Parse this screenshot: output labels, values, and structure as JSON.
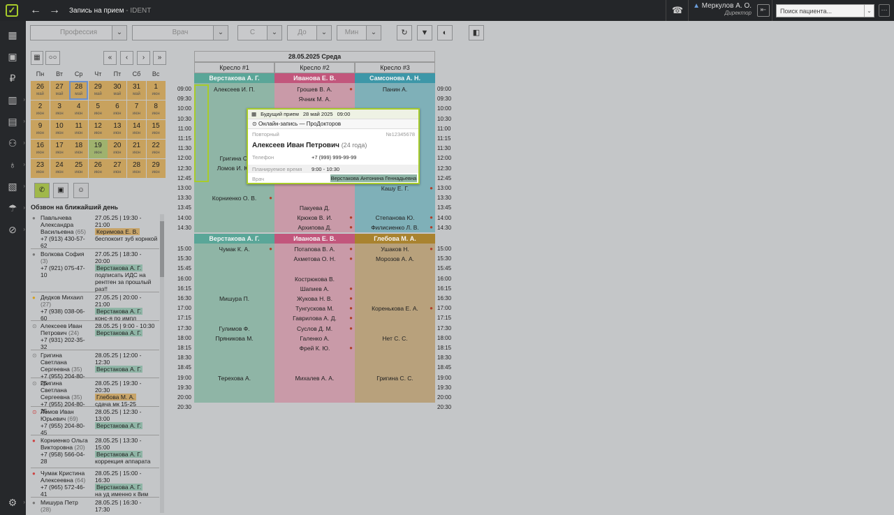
{
  "app": {
    "title": "Запись на прием",
    "subtitle": "- IDENT",
    "user_name": "Меркулов А. О.",
    "user_role": "Директор",
    "search_placeholder": "Поиск пациента...",
    "accent": "#a8cc2a"
  },
  "sidebar": {
    "icons": [
      "schedule-icon",
      "calendar-check-icon",
      "finance-icon",
      "clinic-icon",
      "reports-icon",
      "users-icon",
      "tooth-icon",
      "storage-icon",
      "insurance-icon",
      "marketing-icon",
      "settings-icon"
    ]
  },
  "filters": {
    "profession": "Профессия",
    "doctor": "Врач",
    "from": "С",
    "to": "До",
    "min": "Мин"
  },
  "calendar": {
    "weekdays": [
      "Пн",
      "Вт",
      "Ср",
      "Чт",
      "Пт",
      "Сб",
      "Вс"
    ],
    "rows": [
      [
        {
          "d": "26",
          "m": "май",
          "c": "or"
        },
        {
          "d": "27",
          "m": "май",
          "c": "or"
        },
        {
          "d": "28",
          "m": "май",
          "c": "or",
          "sel": true
        },
        {
          "d": "29",
          "m": "май",
          "c": "or"
        },
        {
          "d": "30",
          "m": "май",
          "c": "or"
        },
        {
          "d": "31",
          "m": "май",
          "c": "or"
        },
        {
          "d": "1",
          "m": "июн",
          "c": "or"
        }
      ],
      [
        {
          "d": "2",
          "m": "июн",
          "c": "or"
        },
        {
          "d": "3",
          "m": "июн",
          "c": "or"
        },
        {
          "d": "4",
          "m": "июн",
          "c": "or"
        },
        {
          "d": "5",
          "m": "июн",
          "c": "or"
        },
        {
          "d": "6",
          "m": "июн",
          "c": "or"
        },
        {
          "d": "7",
          "m": "июн",
          "c": "or"
        },
        {
          "d": "8",
          "m": "июн",
          "c": "or"
        }
      ],
      [
        {
          "d": "9",
          "m": "июн",
          "c": "or"
        },
        {
          "d": "10",
          "m": "июн",
          "c": "or"
        },
        {
          "d": "11",
          "m": "июн",
          "c": "or"
        },
        {
          "d": "12",
          "m": "июн",
          "c": "or"
        },
        {
          "d": "13",
          "m": "июн",
          "c": "or"
        },
        {
          "d": "14",
          "m": "июн",
          "c": "or"
        },
        {
          "d": "15",
          "m": "июн",
          "c": "or"
        }
      ],
      [
        {
          "d": "16",
          "m": "июн",
          "c": "or"
        },
        {
          "d": "17",
          "m": "июн",
          "c": "or"
        },
        {
          "d": "18",
          "m": "июн",
          "c": "or"
        },
        {
          "d": "19",
          "m": "июн",
          "c": "gr"
        },
        {
          "d": "20",
          "m": "июн",
          "c": "or"
        },
        {
          "d": "21",
          "m": "июн",
          "c": "or"
        },
        {
          "d": "22",
          "m": "июн",
          "c": "or"
        }
      ],
      [
        {
          "d": "23",
          "m": "июн",
          "c": "or"
        },
        {
          "d": "24",
          "m": "июн",
          "c": "or"
        },
        {
          "d": "25",
          "m": "июн",
          "c": "or"
        },
        {
          "d": "26",
          "m": "июн",
          "c": "or"
        },
        {
          "d": "27",
          "m": "июн",
          "c": "or"
        },
        {
          "d": "28",
          "m": "июн",
          "c": "or"
        },
        {
          "d": "29",
          "m": "июн",
          "c": "or"
        }
      ]
    ]
  },
  "calls": {
    "header": "Обзвон на ближайший день",
    "items": [
      {
        "name": "Павлычева Александра Васильевна",
        "age": "(65)",
        "phone": "+7 (913) 430-57-62",
        "info": "27.05.25 | 19:30 - 21:00",
        "doctor": "Керимова Е. В.",
        "dc": "o",
        "note": "беспокоит зуб корнкой"
      },
      {
        "name": "Волкова София",
        "age": "(3)",
        "phone": "+7 (921) 075-47-10",
        "info": "27.05.25 | 18:30 - 20:00",
        "doctor": "Верстакова А. Г.",
        "dc": "g",
        "note": "подписать ИДС на рентген за прошлый раз!!"
      },
      {
        "name": "Дедков Михаил",
        "age": "(27)",
        "phone": "+7 (938) 038-06-60",
        "info": "27.05.25 | 20:00 - 21:00",
        "doctor": "Верстакова А. Г.",
        "dc": "g",
        "note": "конс-я по импл"
      },
      {
        "name": "Алексеев Иван Петрович",
        "age": "(24)",
        "phone": "+7 (931) 202-35-32",
        "info": "28.05.25 | 9:00 - 10:30",
        "doctor": "Верстакова А. Г.",
        "dc": "g",
        "note": ""
      },
      {
        "name": "Григина Светлана Сергеевна",
        "age": "(35)",
        "phone": "+7 (955) 204-80-25",
        "info": "28.05.25 | 12:00 - 12:30",
        "doctor": "Верстакова А. Г.",
        "dc": "g",
        "note": ""
      },
      {
        "name": "Григина Светлана Сергеевна",
        "age": "(35)",
        "phone": "+7 (955) 204-80-25",
        "info": "28.05.25 | 19:30 - 20:30",
        "doctor": "Глебова М. А.",
        "dc": "o",
        "note": "сдача мк 15-25"
      },
      {
        "name": "Ломов Иван Юрьевич",
        "age": "(69)",
        "phone": "+7 (955) 204-80-45",
        "info": "28.05.25 | 12:30 - 13:00",
        "doctor": "Верстакова А. Г.",
        "dc": "g",
        "note": ""
      },
      {
        "name": "Корниенко Ольга Викторовна",
        "age": "(20)",
        "phone": "+7 (958) 566-04-28",
        "info": "28.05.25 | 13:30 - 15:00",
        "doctor": "Верстакова А. Г.",
        "dc": "g",
        "note": "коррекция аппарата"
      },
      {
        "name": "Чумак Кристина Алексеевна",
        "age": "(64)",
        "phone": "+7 (965) 572-46-41",
        "info": "28.05.25 | 15:00 - 16:30",
        "doctor": "Верстакова А. Г.",
        "dc": "g",
        "note": "на уд именно к 8им"
      },
      {
        "name": "Мишура Петр",
        "age": "(28)",
        "phone": "+7 (940) 441-54-54",
        "info": "28.05.25 | 16:30 - 17:30",
        "doctor": "Верстакова А. Г.",
        "dc": "g",
        "note": ""
      }
    ]
  },
  "schedule": {
    "date": "28.05.2025 Среда",
    "chairs": [
      "Кресло #1",
      "Кресло #2",
      "Кресло #3"
    ],
    "shift1_doctors": [
      {
        "name": "Верстакова А. Г.",
        "color": "#5aa698"
      },
      {
        "name": "Иванова Е. В.",
        "color": "#c2567c"
      },
      {
        "name": "Самсонова А. Н.",
        "color": "#3d97a8"
      }
    ],
    "shift2_doctors": [
      {
        "name": "Верстакова А. Г.",
        "color": "#5aa698"
      },
      {
        "name": "Иванова Е. В.",
        "color": "#c2567c"
      },
      {
        "name": "Глебова М. А.",
        "color": "#a9832f"
      }
    ],
    "times1": [
      "09:00",
      "09:30",
      "10:00",
      "10:30",
      "11:00",
      "11:15",
      "11:30",
      "12:00",
      "12:30",
      "12:45",
      "13:00",
      "13:30",
      "13:45",
      "14:00",
      "14:30"
    ],
    "times2": [
      "15:00",
      "15:30",
      "15:45",
      "16:00",
      "16:15",
      "16:30",
      "17:00",
      "17:15",
      "17:30",
      "18:00",
      "18:15",
      "18:30",
      "18:45",
      "19:00",
      "19:30",
      "20:00",
      "20:30"
    ],
    "c1_shift1": [
      "Алексеев И. П.",
      "Григина С.",
      "Ломов И. Ю.",
      "Корниенко О. В."
    ],
    "c2_shift1": [
      "Грошев В. А.",
      "Ячник М. А.",
      "Пакуева Д.",
      "Крюков В. И.",
      "Архипова Д."
    ],
    "c3_shift1": [
      "Панин А.",
      "Кашу Е. Г.",
      "Степанова Ю.",
      "Филисиенко Л. В."
    ],
    "c1_shift2": [
      "Чумак К. А.",
      "Мишура П.",
      "Гулимов Ф.",
      "Пряникова М.",
      "Терехова А."
    ],
    "c2_shift2": [
      "Потапова В. А.",
      "Ахметова О. Н.",
      "Кострюкова В.",
      "Шапиев А.",
      "Жукова Н. В.",
      "Тунгускова М.",
      "Гаврилова А. Д.",
      "Суслов Д. М.",
      "Галенко А.",
      "Фрей К. Ю.",
      "Михалев А. А."
    ],
    "c3_shift2": [
      "Ушаков Н.",
      "Морозов А. А.",
      "Кореньковa Е. А.",
      "Нет С. С.",
      "Григина С. С."
    ]
  },
  "popup": {
    "status": "Будущий прием",
    "date": "28 май 2025",
    "time": "09:00",
    "source": "Онлайн-запись — ПроДокторов",
    "kind": "Повторный",
    "number": "№12345678",
    "patient": "Алексеев Иван Петрович",
    "age": "(24 года)",
    "phone_label": "Телефон",
    "phone": "+7 (999) 999-99-99",
    "time_label": "Планируемое время",
    "time_range": "9:00 - 10:30",
    "doctor_label": "Врач",
    "doctor": "Верстакова Антонина Геннадьевна"
  }
}
